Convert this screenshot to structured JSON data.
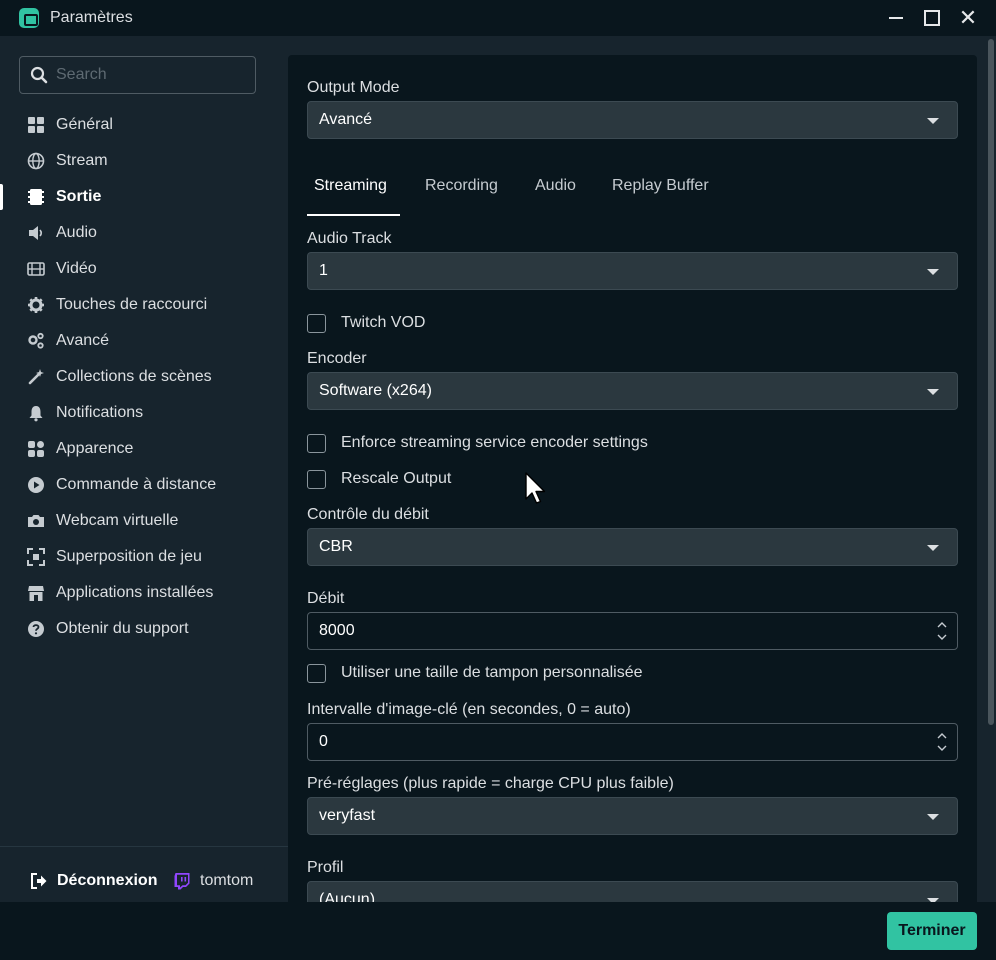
{
  "window": {
    "title": "Paramètres",
    "close_glyph": "✕"
  },
  "colors": {
    "accent": "#31c3a2",
    "panel_bg": "#09161d",
    "sidebar_bg": "#17242d",
    "field_bg": "#2b383f"
  },
  "sidebar": {
    "search_placeholder": "Search",
    "items": [
      {
        "label": "Général",
        "icon": "dashboard-grid-icon",
        "active": false
      },
      {
        "label": "Stream",
        "icon": "globe-icon",
        "active": false
      },
      {
        "label": "Sortie",
        "icon": "film-strip-icon",
        "active": true
      },
      {
        "label": "Audio",
        "icon": "speaker-icon",
        "active": false
      },
      {
        "label": "Vidéo",
        "icon": "video-film-icon",
        "active": false
      },
      {
        "label": "Touches de raccourci",
        "icon": "gear-icon",
        "active": false
      },
      {
        "label": "Avancé",
        "icon": "gears-icon",
        "active": false
      },
      {
        "label": "Collections de scènes",
        "icon": "wand-icon",
        "active": false
      },
      {
        "label": "Notifications",
        "icon": "bell-icon",
        "active": false
      },
      {
        "label": "Apparence",
        "icon": "widgets-icon",
        "active": false
      },
      {
        "label": "Commande à distance",
        "icon": "play-circle-icon",
        "active": false
      },
      {
        "label": "Webcam virtuelle",
        "icon": "camera-icon",
        "active": false
      },
      {
        "label": "Superposition de jeu",
        "icon": "expand-icon",
        "active": false
      },
      {
        "label": "Applications installées",
        "icon": "store-icon",
        "active": false
      },
      {
        "label": "Obtenir du support",
        "icon": "question-circle-icon",
        "active": false
      }
    ],
    "logout_label": "Déconnexion",
    "username": "tomtom"
  },
  "main": {
    "output_mode_label": "Output Mode",
    "output_mode_value": "Avancé",
    "tabs": [
      {
        "label": "Streaming",
        "active": true
      },
      {
        "label": "Recording",
        "active": false
      },
      {
        "label": "Audio",
        "active": false
      },
      {
        "label": "Replay Buffer",
        "active": false
      }
    ],
    "audio_track_label": "Audio Track",
    "audio_track_value": "1",
    "twitch_vod_label": "Twitch VOD",
    "encoder_label": "Encoder",
    "encoder_value": "Software (x264)",
    "enforce_label": "Enforce streaming service encoder settings",
    "rescale_label": "Rescale Output",
    "rate_control_label": "Contrôle du débit",
    "rate_control_value": "CBR",
    "bitrate_label": "Débit",
    "bitrate_value": "8000",
    "buffer_label": "Utiliser une taille de tampon personnalisée",
    "keyframe_label": "Intervalle d'image-clé (en secondes, 0 = auto)",
    "keyframe_value": "0",
    "preset_label": "Pré-réglages (plus rapide = charge CPU plus faible)",
    "preset_value": "veryfast",
    "profile_label": "Profil",
    "profile_value": "(Aucun)"
  },
  "footer": {
    "done_label": "Terminer"
  }
}
